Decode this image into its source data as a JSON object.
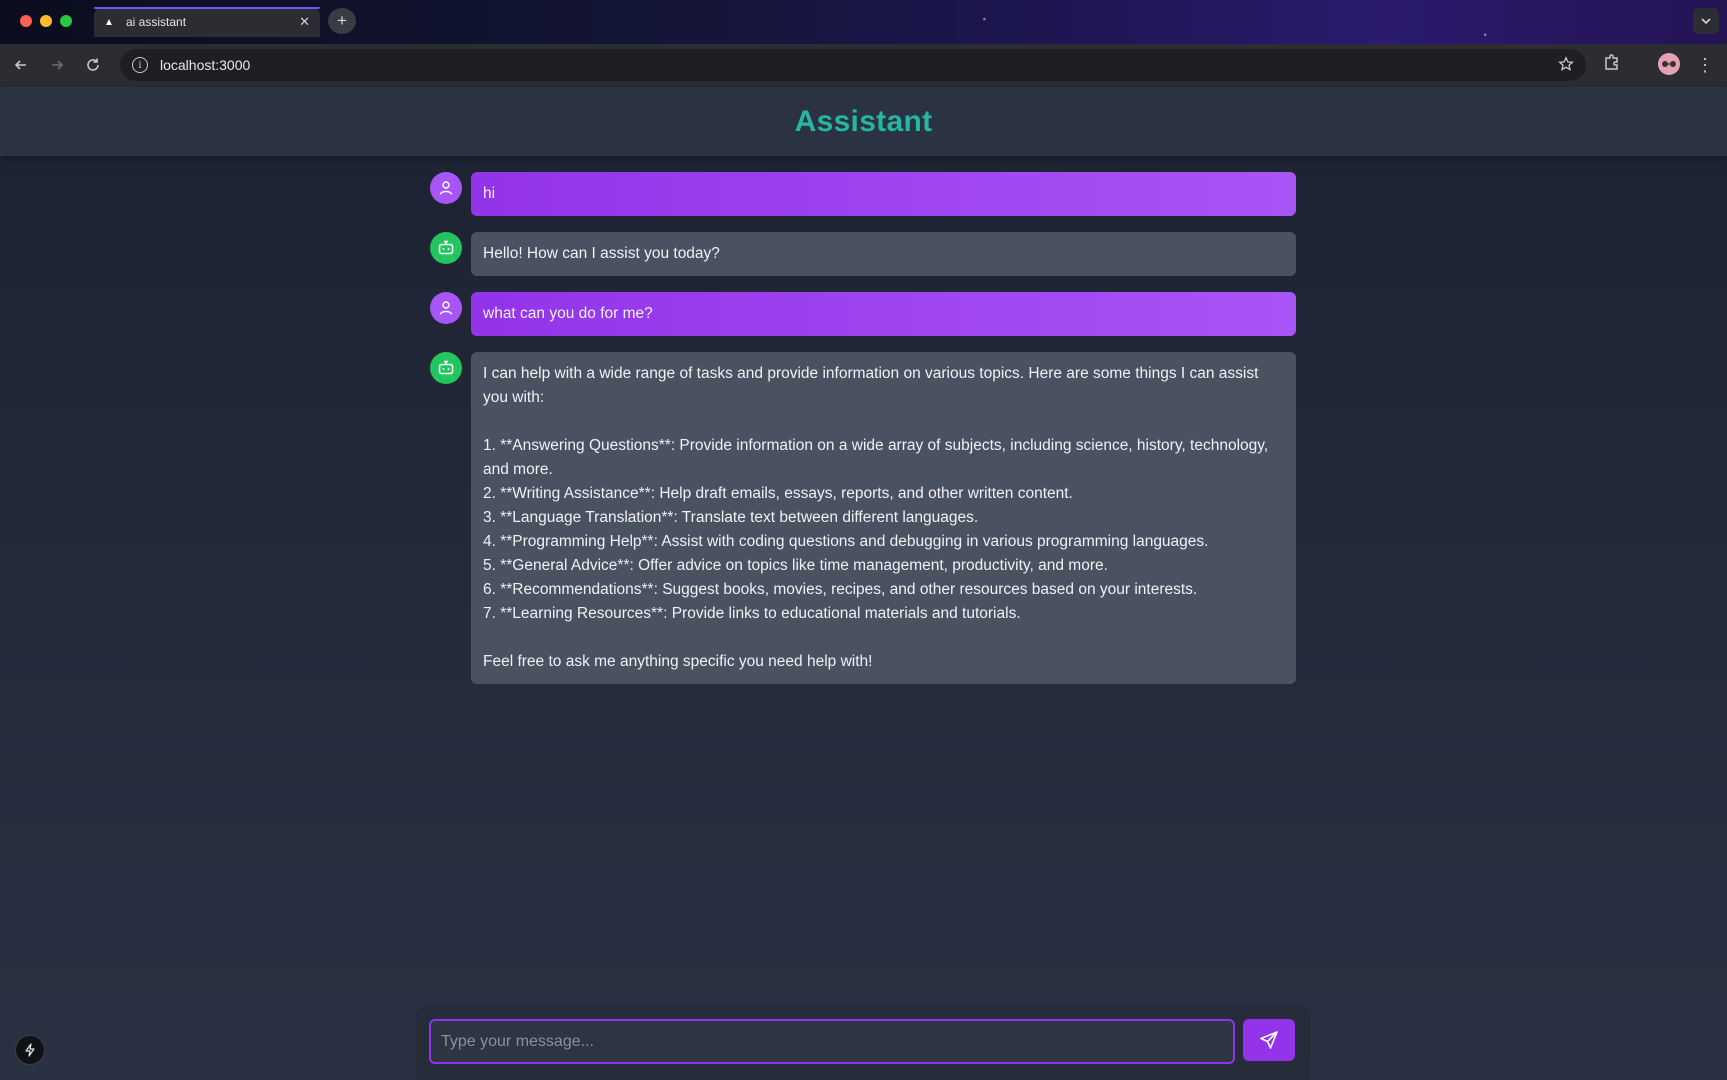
{
  "browser": {
    "tab_title": "ai assistant",
    "tab_favicon": "▲",
    "tab_close": "✕",
    "new_tab": "+",
    "url": "localhost:3000"
  },
  "app": {
    "title": "Assistant"
  },
  "messages": [
    {
      "role": "user",
      "avatar_icon": "user-icon",
      "text": "hi"
    },
    {
      "role": "assistant",
      "avatar_icon": "bot-icon",
      "text": "Hello! How can I assist you today?"
    },
    {
      "role": "user",
      "avatar_icon": "user-icon",
      "text": "what can you do for me?"
    },
    {
      "role": "assistant",
      "avatar_icon": "bot-icon",
      "text": "I can help with a wide range of tasks and provide information on various topics. Here are some things I can assist you with:\n\n1. **Answering Questions**: Provide information on a wide array of subjects, including science, history, technology, and more.\n2. **Writing Assistance**: Help draft emails, essays, reports, and other written content.\n3. **Language Translation**: Translate text between different languages.\n4. **Programming Help**: Assist with coding questions and debugging in various programming languages.\n5. **General Advice**: Offer advice on topics like time management, productivity, and more.\n6. **Recommendations**: Suggest books, movies, recipes, and other resources based on your interests.\n7. **Learning Resources**: Provide links to educational materials and tutorials.\n\nFeel free to ask me anything specific you need help with!"
    }
  ],
  "composer": {
    "placeholder": "Type your message...",
    "value": ""
  },
  "colors": {
    "accent": "#9333ea",
    "user_bubble": "#a855f7",
    "bot_bubble": "#4a5160",
    "bot_avatar": "#22c55e",
    "title": "#25b6a4"
  }
}
